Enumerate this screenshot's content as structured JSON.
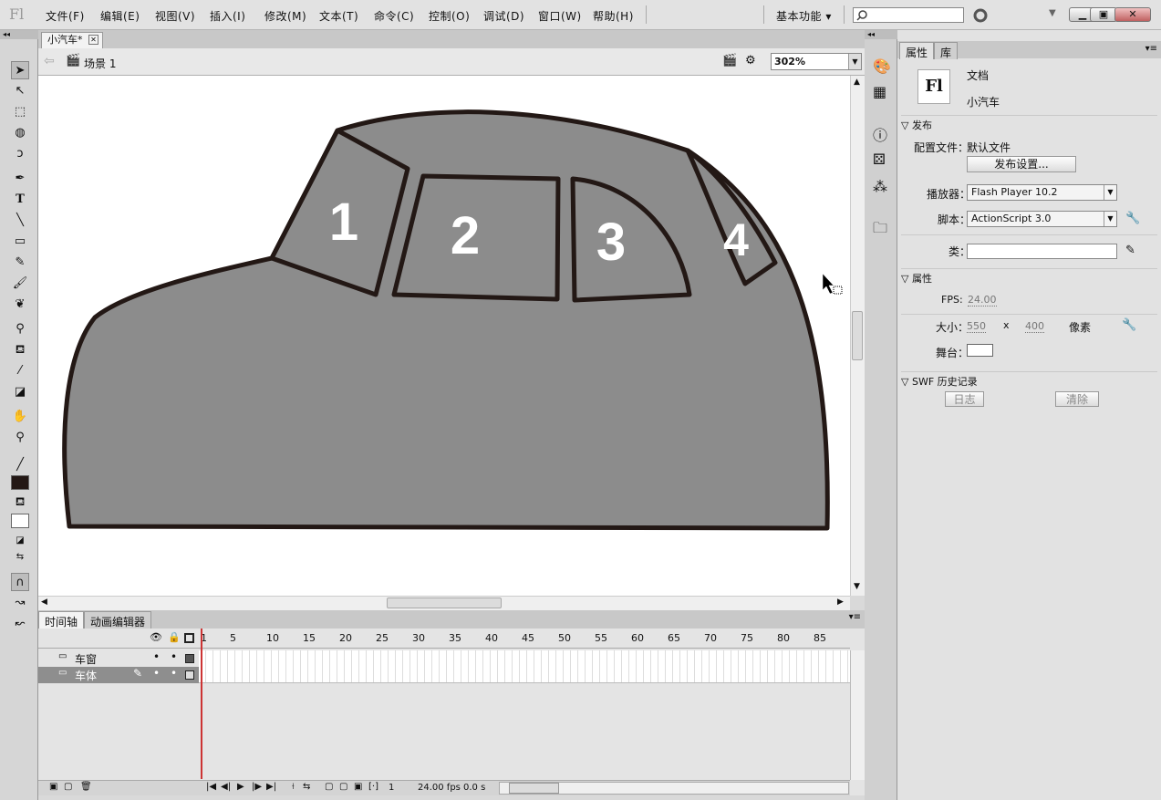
{
  "menubar": {
    "logo": "Fl",
    "items": [
      "文件(F)",
      "编辑(E)",
      "视图(V)",
      "插入(I)",
      "修改(M)",
      "文本(T)",
      "命令(C)",
      "控制(O)",
      "调试(D)",
      "窗口(W)",
      "帮助(H)"
    ],
    "workspace": "基本功能 ▾",
    "search_placeholder": ""
  },
  "document": {
    "tab_label": "小汽车*",
    "scene_label": "场景 1",
    "zoom": "302%"
  },
  "stage": {
    "fill_color": "#8c8c8c",
    "stroke_color": "#231815",
    "window_labels": [
      "1",
      "2",
      "3",
      "4"
    ]
  },
  "timeline": {
    "tabs": [
      "时间轴",
      "动画编辑器"
    ],
    "frame_numbers": [
      "1",
      "5",
      "10",
      "15",
      "20",
      "25",
      "30",
      "35",
      "40",
      "45",
      "50",
      "55",
      "60",
      "65",
      "70",
      "75",
      "80",
      "85"
    ],
    "layers": [
      {
        "name": "车窗",
        "selected": false
      },
      {
        "name": "车体",
        "selected": true
      }
    ],
    "current_frame": "1",
    "fps": "24.00 fps",
    "time": "0.0 s"
  },
  "properties": {
    "tabs": [
      "属性",
      "库"
    ],
    "doc_icon": "Fl",
    "doc_type": "文档",
    "doc_name": "小汽车",
    "publish_header": "发布",
    "profile_label": "配置文件：",
    "profile_value": "默认文件",
    "publish_settings_button": "发布设置...",
    "player_label": "播放器：",
    "player_value": "Flash Player 10.2",
    "script_label": "脚本：",
    "script_value": "ActionScript 3.0",
    "class_label": "类：",
    "attributes_header": "属性",
    "fps_label": "FPS:",
    "fps_value": "24.00",
    "size_label": "大小：",
    "width": "550",
    "x_sep": "x",
    "height": "400",
    "unit": "像素",
    "stage_label": "舞台：",
    "swf_history_header": "SWF 历史记录",
    "log_button": "日志",
    "clear_button": "清除"
  }
}
